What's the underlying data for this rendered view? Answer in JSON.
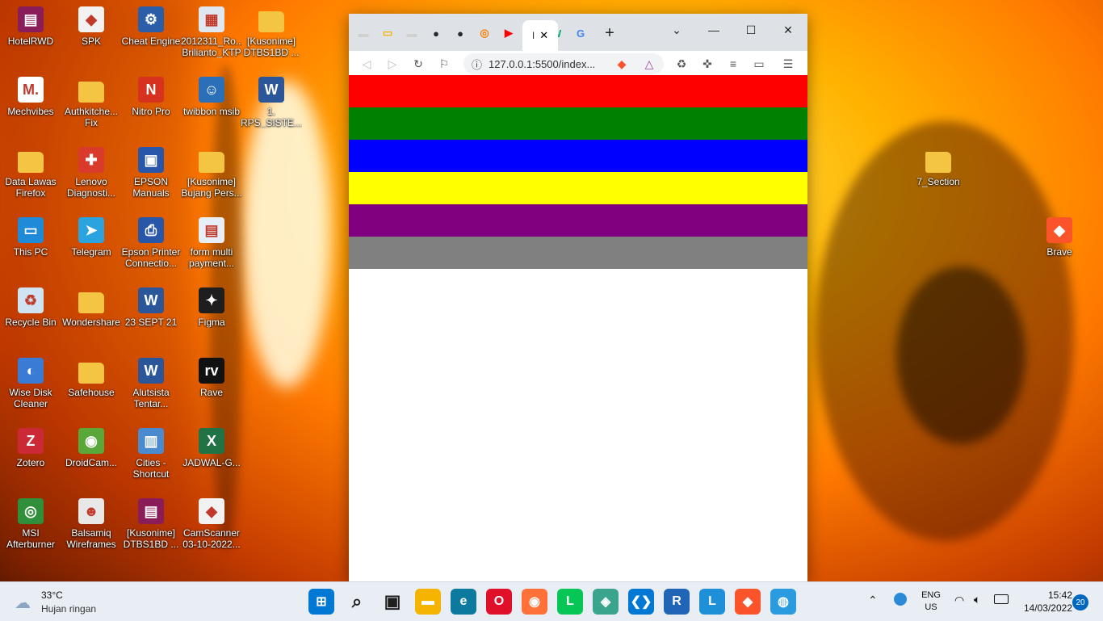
{
  "desktop": {
    "icons": [
      {
        "label": "HotelRWD",
        "icon": "winrar-icon",
        "color": "#8b1c5a",
        "glyph": "▤"
      },
      {
        "label": "SPK",
        "icon": "brave-file-icon",
        "color": "#f2f2f2",
        "glyph": "◆"
      },
      {
        "label": "Cheat Engine",
        "icon": "cheat-engine-icon",
        "color": "#2a5ea8",
        "glyph": "⚙"
      },
      {
        "label": "2012311_Ro... Brilianto_KTP",
        "icon": "image-file-icon",
        "color": "#dfe7f0",
        "glyph": "▦"
      },
      {
        "label": "[Kusonime] DTBS1BD ...",
        "icon": "folder-icon",
        "color": "#f4c542",
        "glyph": ""
      },
      {
        "label": "Mechvibes",
        "icon": "mechvibes-icon",
        "color": "#ffffff",
        "glyph": "M."
      },
      {
        "label": "Authkitche... Fix",
        "icon": "folder-icon",
        "color": "#f4c542",
        "glyph": ""
      },
      {
        "label": "Nitro Pro",
        "icon": "nitro-pro-icon",
        "color": "#d6321f",
        "glyph": "N"
      },
      {
        "label": "twibbon msib",
        "icon": "image-file-icon",
        "color": "#2a6fb8",
        "glyph": "☺"
      },
      {
        "label": "1. RPS_SISTE...",
        "icon": "word-doc-icon",
        "color": "#2b579a",
        "glyph": "W"
      },
      {
        "label": "Data Lawas Firefox",
        "icon": "folder-icon",
        "color": "#f4c542",
        "glyph": ""
      },
      {
        "label": "Lenovo Diagnosti...",
        "icon": "lenovo-diagnostics-icon",
        "color": "#d93a2b",
        "glyph": "✚"
      },
      {
        "label": "EPSON Manuals",
        "icon": "epson-manuals-icon",
        "color": "#2856a8",
        "glyph": "▣"
      },
      {
        "label": "[Kusonime] Bujang Pers...",
        "icon": "folder-icon",
        "color": "#f4c542",
        "glyph": ""
      },
      {
        "label": "This PC",
        "icon": "this-pc-icon",
        "color": "#1f8ad8",
        "glyph": "▭"
      },
      {
        "label": "Telegram",
        "icon": "telegram-icon",
        "color": "#2aa3df",
        "glyph": "➤"
      },
      {
        "label": "Epson Printer Connectio...",
        "icon": "epson-printer-icon",
        "color": "#2856a8",
        "glyph": "⎙"
      },
      {
        "label": "form multi payment...",
        "icon": "image-file-icon",
        "color": "#e8eef6",
        "glyph": "▤"
      },
      {
        "label": "Recycle Bin",
        "icon": "recycle-bin-icon",
        "color": "#cfe3f3",
        "glyph": "♻"
      },
      {
        "label": "Wondershare",
        "icon": "folder-icon",
        "color": "#f4c542",
        "glyph": ""
      },
      {
        "label": "23 SEPT 21",
        "icon": "word-doc-icon",
        "color": "#2b579a",
        "glyph": "W"
      },
      {
        "label": "Figma",
        "icon": "figma-icon",
        "color": "#1e1e1e",
        "glyph": "✦"
      },
      {
        "label": "Wise Disk Cleaner",
        "icon": "wise-disk-cleaner-icon",
        "color": "#3a7bd5",
        "glyph": "◐"
      },
      {
        "label": "Safehouse",
        "icon": "folder-icon",
        "color": "#f4c542",
        "glyph": ""
      },
      {
        "label": "Alutsista Tentar...",
        "icon": "word-doc-icon",
        "color": "#2b579a",
        "glyph": "W"
      },
      {
        "label": "Rave",
        "icon": "rave-icon",
        "color": "#111111",
        "glyph": "rv"
      },
      {
        "label": "Zotero",
        "icon": "zotero-icon",
        "color": "#cc2936",
        "glyph": "Z"
      },
      {
        "label": "DroidCam...",
        "icon": "droidcam-icon",
        "color": "#5aa83a",
        "glyph": "◉"
      },
      {
        "label": "Cities - Shortcut",
        "icon": "cities-icon",
        "color": "#4a8bd0",
        "glyph": "▥"
      },
      {
        "label": "JADWAL-G...",
        "icon": "excel-icon",
        "color": "#217346",
        "glyph": "X"
      },
      {
        "label": "MSI Afterburner",
        "icon": "msi-afterburner-icon",
        "color": "#2f8f3a",
        "glyph": "◎"
      },
      {
        "label": "Balsamiq Wireframes",
        "icon": "balsamiq-icon",
        "color": "#e8e8e8",
        "glyph": "☻"
      },
      {
        "label": "[Kusonime] DTBS1BD ...",
        "icon": "winrar-icon",
        "color": "#8b1c5a",
        "glyph": "▤"
      },
      {
        "label": "CamScanner 03-10-2022...",
        "icon": "brave-file-icon",
        "color": "#f2f2f2",
        "glyph": "◆"
      }
    ],
    "right_icons": [
      {
        "label": "7_Section",
        "icon": "folder-icon",
        "color": "#f4c542",
        "glyph": ""
      },
      {
        "label": "Brave",
        "icon": "brave-icon",
        "color": "#fb542b",
        "glyph": "◆"
      }
    ]
  },
  "browser": {
    "address": "127.0.0.1:5500/index...",
    "tab_active_label": "I",
    "tabs": [
      {
        "icon": "site-favicon-icon",
        "glyph": "▬",
        "color": "#d0d0d0"
      },
      {
        "icon": "google-slides-icon",
        "glyph": "▭",
        "color": "#f4b400"
      },
      {
        "icon": "site-favicon-icon",
        "glyph": "▬",
        "color": "#d0d0d0"
      },
      {
        "icon": "github-icon",
        "glyph": "●",
        "color": "#24292e"
      },
      {
        "icon": "github-icon",
        "glyph": "●",
        "color": "#24292e"
      },
      {
        "icon": "orange-app-icon",
        "glyph": "◎",
        "color": "#f57c00"
      },
      {
        "icon": "youtube-icon",
        "glyph": "▶",
        "color": "#ff0000"
      },
      {
        "icon": "w3schools-icon",
        "glyph": "W",
        "color": "#04aa6d"
      },
      {
        "icon": "google-icon",
        "glyph": "G",
        "color": "#4285f4"
      }
    ],
    "stripes": [
      "#ff0000",
      "#008000",
      "#0000ff",
      "#ffff00",
      "#800080",
      "#808080"
    ]
  },
  "taskbar": {
    "weather_temp": "33°C",
    "weather_desc": "Hujan ringan",
    "lang_line1": "ENG",
    "lang_line2": "US",
    "time": "15:42",
    "date": "14/03/2022",
    "notification_count": "20",
    "apps": [
      {
        "name": "start-icon",
        "glyph": "⊞",
        "color": "#0078d4"
      },
      {
        "name": "search-icon",
        "glyph": "⌕",
        "color": "#1f1f1f"
      },
      {
        "name": "task-view-icon",
        "glyph": "▣",
        "color": "#1f1f1f"
      },
      {
        "name": "file-explorer-icon",
        "glyph": "▬",
        "color": "#f4b400"
      },
      {
        "name": "edge-icon",
        "glyph": "e",
        "color": "#0c7a9e"
      },
      {
        "name": "opera-icon",
        "glyph": "O",
        "color": "#e0102b"
      },
      {
        "name": "firefox-icon",
        "glyph": "◉",
        "color": "#ff7139"
      },
      {
        "name": "line-icon",
        "glyph": "L",
        "color": "#06c755"
      },
      {
        "name": "app-green-icon",
        "glyph": "◈",
        "color": "#3aa58c"
      },
      {
        "name": "vscode-icon",
        "glyph": "❮❯",
        "color": "#0078d4"
      },
      {
        "name": "r-icon",
        "glyph": "R",
        "color": "#2165b6"
      },
      {
        "name": "l-app-icon",
        "glyph": "L",
        "color": "#1e90d8"
      },
      {
        "name": "brave-icon",
        "glyph": "◆",
        "color": "#fb542b"
      },
      {
        "name": "globe-app-icon",
        "glyph": "◍",
        "color": "#2b9be0"
      }
    ]
  }
}
